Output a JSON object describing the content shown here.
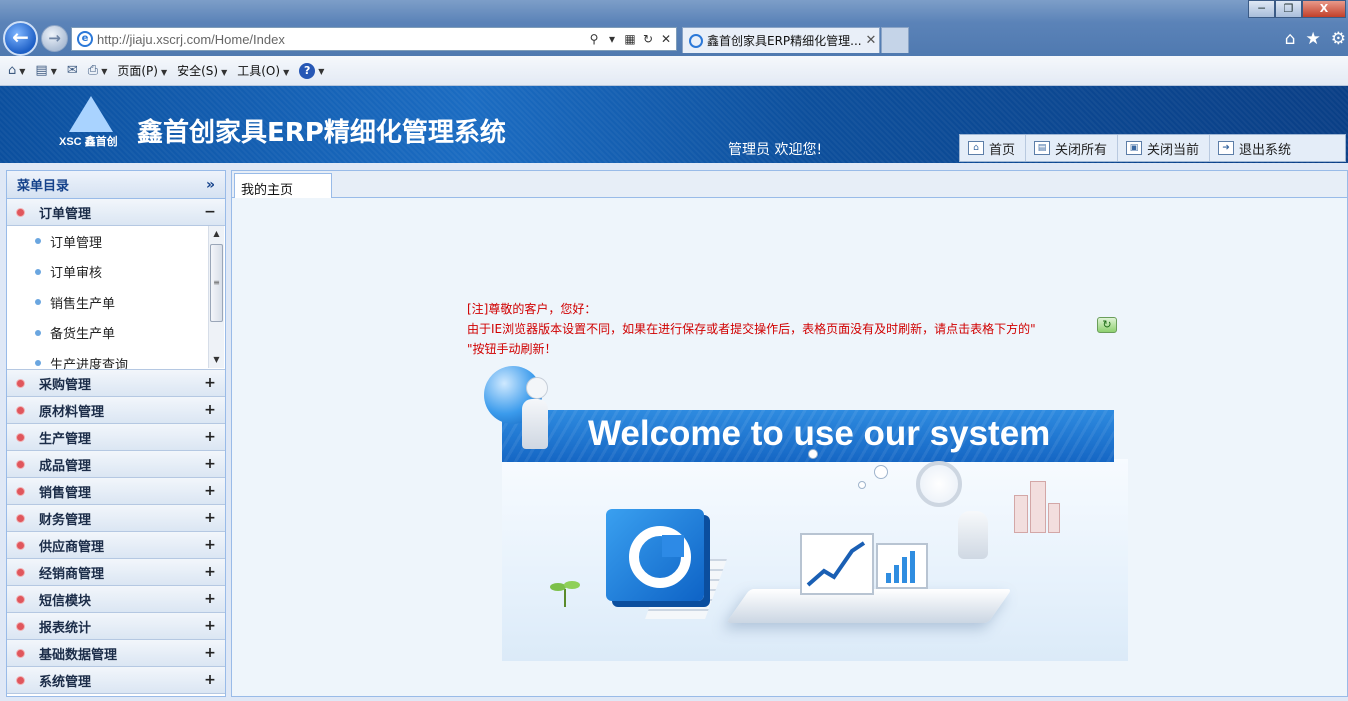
{
  "browser": {
    "url": "http://jiaju.xscrj.com/Home/Index",
    "tab_title": "鑫首创家具ERP精细化管理...",
    "menus": [
      "页面(P)",
      "安全(S)",
      "工具(O)"
    ]
  },
  "header": {
    "logo_text": "XSC 鑫首创",
    "title": "鑫首创家具ERP精细化管理系统",
    "welcome": "管理员 欢迎您!",
    "buttons": {
      "home": "首页",
      "close_all": "关闭所有",
      "close_current": "关闭当前",
      "logout": "退出系统"
    }
  },
  "sidebar": {
    "title": "菜单目录",
    "collapse_glyph": "»",
    "expanded_group": {
      "label": "订单管理",
      "toggle": "−"
    },
    "sub_items": [
      "订单管理",
      "订单审核",
      "销售生产单",
      "备货生产单",
      "生产进度查询"
    ],
    "groups": [
      "采购管理",
      "原材料管理",
      "生产管理",
      "成品管理",
      "销售管理",
      "财务管理",
      "供应商管理",
      "经销商管理",
      "短信模块",
      "报表统计",
      "基础数据管理",
      "系统管理"
    ],
    "expand_glyph": "+"
  },
  "main": {
    "tab_label": "我的主页",
    "notice_line1": "[注]尊敬的客户，您好：",
    "notice_line2": "由于IE浏览器版本设置不同，如果在进行保存或者提交操作后，表格页面没有及时刷新，请点击表格下方的\"",
    "notice_line3": "\"按钮手动刷新！",
    "banner_text": "Welcome to use our system"
  },
  "colors": {
    "accent": "#15428b",
    "notice": "#d00000",
    "header_blue": "#0b4f9e"
  }
}
